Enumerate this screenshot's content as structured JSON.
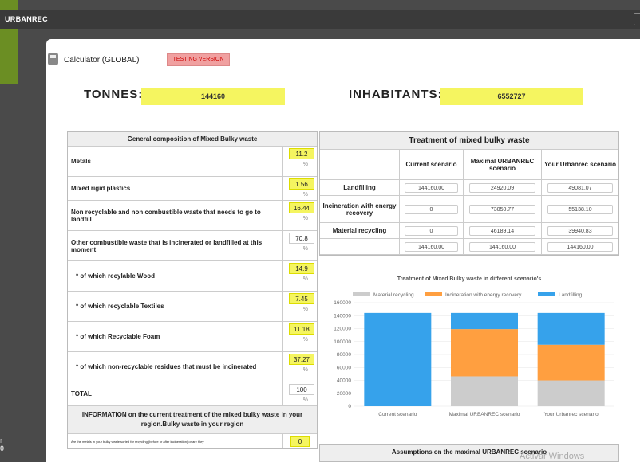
{
  "app": {
    "brand": "URBANREC"
  },
  "calc": {
    "title": "Calculator (GLOBAL)",
    "badge": "TESTING VERSION"
  },
  "tonnes": {
    "label": "TONNES:",
    "value": "144160"
  },
  "inhabitants": {
    "label": "INHABITANTS:",
    "value": "6552727"
  },
  "composition": {
    "header": "General composition of Mixed Bulky waste",
    "pct_symbol": "%",
    "rows": [
      {
        "label": "Metals",
        "value": "11.2",
        "yellow": true
      },
      {
        "label": "Mixed rigid plastics",
        "value": "1.56",
        "yellow": true
      },
      {
        "label": "Non recyclable and non combustible waste that needs to go to landfill",
        "value": "16.44",
        "yellow": true
      },
      {
        "label": "Other combustible waste that is incinerated or landfilled at this moment",
        "value": "70.8",
        "yellow": false
      },
      {
        "label": "* of which recylable Wood",
        "value": "14.9",
        "yellow": true
      },
      {
        "label": "* of which recyclable Textiles",
        "value": "7.45",
        "yellow": true
      },
      {
        "label": "* of which Recyclable Foam",
        "value": "11.18",
        "yellow": true
      },
      {
        "label": "* of which non-recyclable residues that must be incinerated",
        "value": "37.27",
        "yellow": true
      },
      {
        "label": "TOTAL",
        "value": "100",
        "yellow": false
      }
    ],
    "info_header": "INFORMATION on the current treatment of the mixed bulky waste in your region.Bulky waste in your region",
    "last_row_label": "Are the metals in your bulky waste sorted for recycling (before or after incineration) or are they",
    "last_row_value": "0"
  },
  "treatment": {
    "header": "Treatment of mixed bulky waste",
    "columns": [
      "Current scenario",
      "Maximal URBANREC scenario",
      "Your Urbanrec scenario"
    ],
    "rows": [
      {
        "label": "Landfilling",
        "values": [
          "144160.00",
          "24920.09",
          "49081.07"
        ]
      },
      {
        "label": "Incineration with energy recovery",
        "values": [
          "0",
          "73050.77",
          "55138.10"
        ]
      },
      {
        "label": "Material recycling",
        "values": [
          "0",
          "46189.14",
          "39940.83"
        ]
      },
      {
        "label": "",
        "values": [
          "144160.00",
          "144160.00",
          "144160.00"
        ]
      }
    ]
  },
  "chart_data": {
    "type": "bar",
    "stacked": true,
    "title": "Treatment of Mixed Bulky waste in different scenario's",
    "categories": [
      "Current scenario",
      "Maximal URBANREC scenario",
      "Your Urbanrec scenario"
    ],
    "series": [
      {
        "name": "Material recycling",
        "color": "#cccccc",
        "values": [
          0,
          46189.14,
          39940.83
        ]
      },
      {
        "name": "Incineration with energy recovery",
        "color": "#ff9f40",
        "values": [
          0,
          73050.77,
          55138.1
        ]
      },
      {
        "name": "Landfilling",
        "color": "#36a2eb",
        "values": [
          144160.0,
          24920.09,
          49081.07
        ]
      }
    ],
    "ylim": [
      0,
      160000
    ],
    "yticks": [
      "0",
      "20000",
      "40000",
      "60000",
      "80000",
      "100000",
      "120000",
      "140000",
      "160000"
    ],
    "legend": "top"
  },
  "assumptions": {
    "header": "Assumptions on the maximal URBANREC scenario"
  },
  "watermark": "Activar Windows",
  "edge": {
    "a": "r",
    "b": "0"
  }
}
